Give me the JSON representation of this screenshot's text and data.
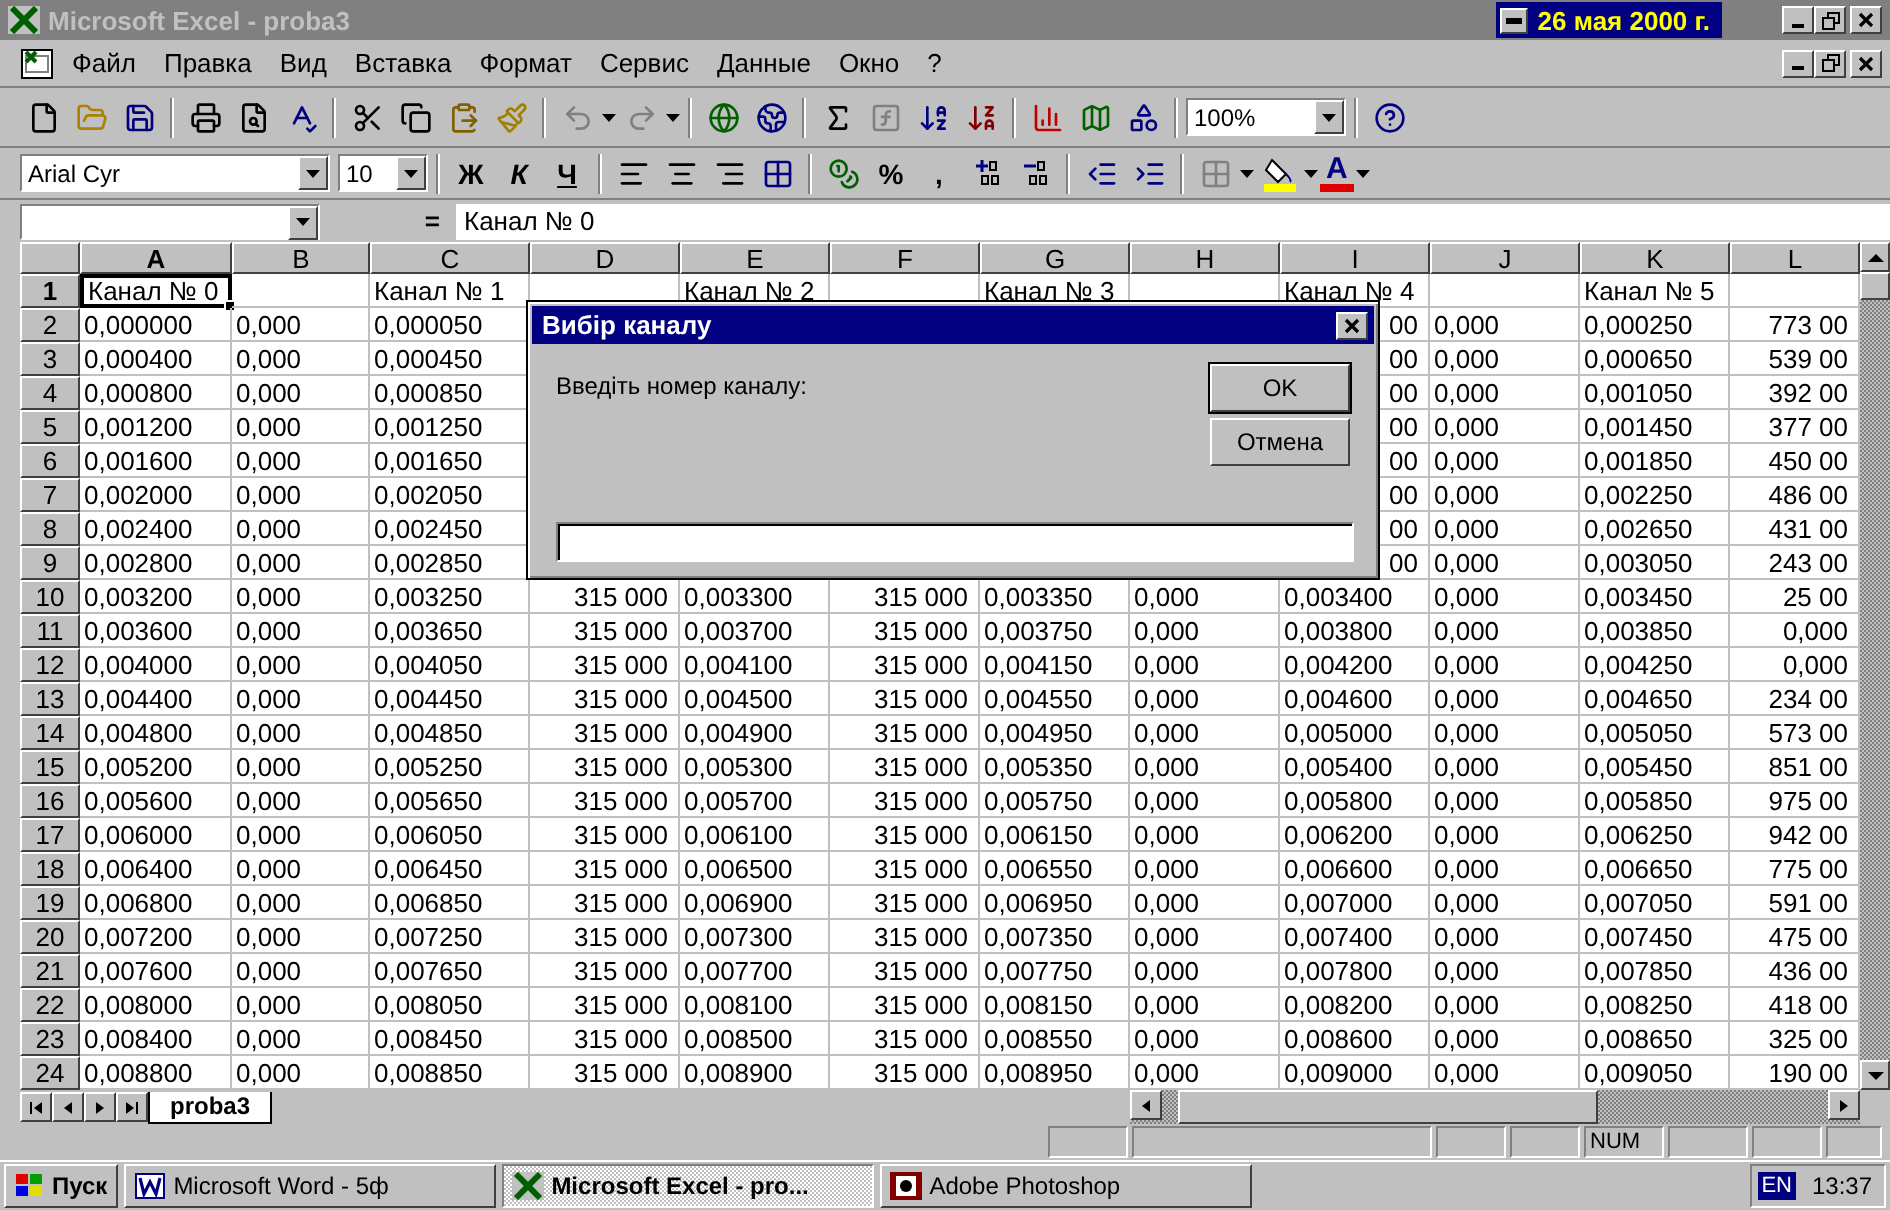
{
  "window": {
    "title": "Microsoft Excel - proba3",
    "date": "26 мая 2000 г."
  },
  "menu": [
    "Файл",
    "Правка",
    "Вид",
    "Вставка",
    "Формат",
    "Сервис",
    "Данные",
    "Окно",
    "?"
  ],
  "standard_toolbar": {
    "zoom": "100%"
  },
  "formatting_toolbar": {
    "font": "Arial Cyr",
    "size": "10",
    "style_buttons": [
      "Ж",
      "К",
      "Ч"
    ],
    "number_buttons": [
      "%",
      ","
    ],
    "font_color_button": "A"
  },
  "formula_bar": {
    "equals": "=",
    "content": "Канал № 0"
  },
  "sheet": {
    "columns": [
      {
        "label": "A",
        "selected": true
      },
      {
        "label": "B",
        "selected": false
      },
      {
        "label": "C",
        "selected": false
      },
      {
        "label": "D",
        "selected": false
      },
      {
        "label": "E",
        "selected": false
      },
      {
        "label": "F",
        "selected": false
      },
      {
        "label": "G",
        "selected": false
      },
      {
        "label": "H",
        "selected": false
      },
      {
        "label": "I",
        "selected": false
      },
      {
        "label": "J",
        "selected": false
      },
      {
        "label": "K",
        "selected": false
      },
      {
        "label": "L",
        "selected": false
      }
    ],
    "rows": [
      {
        "label": "1",
        "selected": true,
        "cells": [
          "Канал № 0",
          null,
          "Канал № 1",
          null,
          "Канал № 2",
          null,
          "Канал № 3",
          null,
          "Канал № 4",
          null,
          "Канал № 5",
          null
        ]
      },
      {
        "label": "2",
        "selected": false,
        "cells": [
          "0,000000",
          "0,000",
          "0,000050",
          null,
          null,
          null,
          null,
          null,
          {
            "text": "00",
            "kind": "covered"
          },
          "0,000",
          "0,000250",
          "773 00"
        ]
      },
      {
        "label": "3",
        "selected": false,
        "cells": [
          "0,000400",
          "0,000",
          "0,000450",
          null,
          null,
          null,
          null,
          null,
          {
            "text": "00",
            "kind": "covered"
          },
          "0,000",
          "0,000650",
          "539 00"
        ]
      },
      {
        "label": "4",
        "selected": false,
        "cells": [
          "0,000800",
          "0,000",
          "0,000850",
          null,
          null,
          null,
          null,
          null,
          {
            "text": "00",
            "kind": "covered"
          },
          "0,000",
          "0,001050",
          "392 00"
        ]
      },
      {
        "label": "5",
        "selected": false,
        "cells": [
          "0,001200",
          "0,000",
          "0,001250",
          null,
          null,
          null,
          null,
          null,
          {
            "text": "00",
            "kind": "covered"
          },
          "0,000",
          "0,001450",
          "377 00"
        ]
      },
      {
        "label": "6",
        "selected": false,
        "cells": [
          "0,001600",
          "0,000",
          "0,001650",
          null,
          null,
          null,
          null,
          null,
          {
            "text": "00",
            "kind": "covered"
          },
          "0,000",
          "0,001850",
          "450 00"
        ]
      },
      {
        "label": "7",
        "selected": false,
        "cells": [
          "0,002000",
          "0,000",
          "0,002050",
          null,
          null,
          null,
          null,
          null,
          {
            "text": "00",
            "kind": "covered"
          },
          "0,000",
          "0,002250",
          "486 00"
        ]
      },
      {
        "label": "8",
        "selected": false,
        "cells": [
          "0,002400",
          "0,000",
          "0,002450",
          null,
          null,
          null,
          null,
          null,
          {
            "text": "00",
            "kind": "covered"
          },
          "0,000",
          "0,002650",
          "431 00"
        ]
      },
      {
        "label": "9",
        "selected": false,
        "cells": [
          "0,002800",
          "0,000",
          "0,002850",
          null,
          null,
          null,
          null,
          null,
          {
            "text": "00",
            "kind": "covered"
          },
          "0,000",
          "0,003050",
          "243 00"
        ]
      },
      {
        "label": "10",
        "selected": false,
        "cells": [
          "0,003200",
          "0,000",
          "0,003250",
          "315 000",
          "0,003300",
          "315 000",
          "0,003350",
          "0,000",
          "0,003400",
          "0,000",
          "0,003450",
          "25 00"
        ]
      },
      {
        "label": "11",
        "selected": false,
        "cells": [
          "0,003600",
          "0,000",
          "0,003650",
          "315 000",
          "0,003700",
          "315 000",
          "0,003750",
          "0,000",
          "0,003800",
          "0,000",
          "0,003850",
          "0,000"
        ]
      },
      {
        "label": "12",
        "selected": false,
        "cells": [
          "0,004000",
          "0,000",
          "0,004050",
          "315 000",
          "0,004100",
          "315 000",
          "0,004150",
          "0,000",
          "0,004200",
          "0,000",
          "0,004250",
          "0,000"
        ]
      },
      {
        "label": "13",
        "selected": false,
        "cells": [
          "0,004400",
          "0,000",
          "0,004450",
          "315 000",
          "0,004500",
          "315 000",
          "0,004550",
          "0,000",
          "0,004600",
          "0,000",
          "0,004650",
          "234 00"
        ]
      },
      {
        "label": "14",
        "selected": false,
        "cells": [
          "0,004800",
          "0,000",
          "0,004850",
          "315 000",
          "0,004900",
          "315 000",
          "0,004950",
          "0,000",
          "0,005000",
          "0,000",
          "0,005050",
          "573 00"
        ]
      },
      {
        "label": "15",
        "selected": false,
        "cells": [
          "0,005200",
          "0,000",
          "0,005250",
          "315 000",
          "0,005300",
          "315 000",
          "0,005350",
          "0,000",
          "0,005400",
          "0,000",
          "0,005450",
          "851 00"
        ]
      },
      {
        "label": "16",
        "selected": false,
        "cells": [
          "0,005600",
          "0,000",
          "0,005650",
          "315 000",
          "0,005700",
          "315 000",
          "0,005750",
          "0,000",
          "0,005800",
          "0,000",
          "0,005850",
          "975 00"
        ]
      },
      {
        "label": "17",
        "selected": false,
        "cells": [
          "0,006000",
          "0,000",
          "0,006050",
          "315 000",
          "0,006100",
          "315 000",
          "0,006150",
          "0,000",
          "0,006200",
          "0,000",
          "0,006250",
          "942 00"
        ]
      },
      {
        "label": "18",
        "selected": false,
        "cells": [
          "0,006400",
          "0,000",
          "0,006450",
          "315 000",
          "0,006500",
          "315 000",
          "0,006550",
          "0,000",
          "0,006600",
          "0,000",
          "0,006650",
          "775 00"
        ]
      },
      {
        "label": "19",
        "selected": false,
        "cells": [
          "0,006800",
          "0,000",
          "0,006850",
          "315 000",
          "0,006900",
          "315 000",
          "0,006950",
          "0,000",
          "0,007000",
          "0,000",
          "0,007050",
          "591 00"
        ]
      },
      {
        "label": "20",
        "selected": false,
        "cells": [
          "0,007200",
          "0,000",
          "0,007250",
          "315 000",
          "0,007300",
          "315 000",
          "0,007350",
          "0,000",
          "0,007400",
          "0,000",
          "0,007450",
          "475 00"
        ]
      },
      {
        "label": "21",
        "selected": false,
        "cells": [
          "0,007600",
          "0,000",
          "0,007650",
          "315 000",
          "0,007700",
          "315 000",
          "0,007750",
          "0,000",
          "0,007800",
          "0,000",
          "0,007850",
          "436 00"
        ]
      },
      {
        "label": "22",
        "selected": false,
        "cells": [
          "0,008000",
          "0,000",
          "0,008050",
          "315 000",
          "0,008100",
          "315 000",
          "0,008150",
          "0,000",
          "0,008200",
          "0,000",
          "0,008250",
          "418 00"
        ]
      },
      {
        "label": "23",
        "selected": false,
        "cells": [
          "0,008400",
          "0,000",
          "0,008450",
          "315 000",
          "0,008500",
          "315 000",
          "0,008550",
          "0,000",
          "0,008600",
          "0,000",
          "0,008650",
          "325 00"
        ]
      },
      {
        "label": "24",
        "selected": false,
        "cells": [
          "0,008800",
          "0,000",
          "0,008850",
          "315 000",
          "0,008900",
          "315 000",
          "0,008950",
          "0,000",
          "0,009000",
          "0,000",
          "0,009050",
          "190 00"
        ]
      }
    ]
  },
  "dialog": {
    "title": "Вибір каналу",
    "prompt": "Введіть номер каналу:",
    "buttons": [
      {
        "label": "OK",
        "default": true
      },
      {
        "label": "Отмена",
        "default": false
      }
    ]
  },
  "sheet_tabs": [
    {
      "label": "proba3",
      "selected": true
    }
  ],
  "status_bar": {
    "indicators": [
      "NUM"
    ]
  },
  "taskbar": {
    "start": "Пуск",
    "tasks": [
      {
        "label": "Microsoft Word - 5ф",
        "kind": "word",
        "selected": false
      },
      {
        "label": "Microsoft Excel - pro...",
        "kind": "excel",
        "selected": true
      },
      {
        "label": "Adobe Photoshop",
        "kind": "photoshop",
        "selected": false
      }
    ],
    "language": "EN",
    "clock": "13:37"
  }
}
